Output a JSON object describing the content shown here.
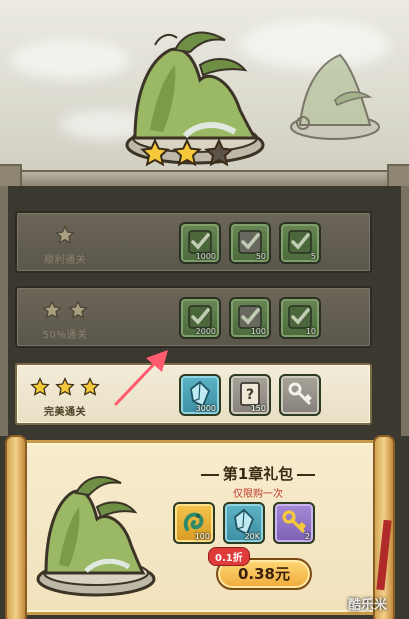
{
  "level": {
    "stars_earned": 2,
    "stars_total": 3
  },
  "tiers": [
    {
      "label": "顺利通关",
      "stars": 1,
      "rewards": [
        {
          "icon": "green-check-token-icon",
          "qty": "1000"
        },
        {
          "icon": "green-check-token-icon",
          "qty": "50"
        },
        {
          "icon": "green-check-token-icon",
          "qty": "5"
        }
      ]
    },
    {
      "label": "50%通关",
      "stars": 2,
      "rewards": [
        {
          "icon": "green-check-token-icon",
          "qty": "2000"
        },
        {
          "icon": "green-check-token-icon",
          "qty": "100"
        },
        {
          "icon": "green-check-token-icon",
          "qty": "10"
        }
      ]
    },
    {
      "label": "完美通关",
      "stars": 3,
      "rewards": [
        {
          "icon": "blue-crystal-icon",
          "qty": "3000"
        },
        {
          "icon": "mystery-scroll-icon",
          "qty": "150"
        },
        {
          "icon": "key-icon",
          "qty": ""
        }
      ]
    }
  ],
  "gift_pack": {
    "title": "第1章礼包",
    "limit_text": "仅限购一次",
    "items": [
      {
        "icon": "jade-dragon-icon",
        "qty": "100"
      },
      {
        "icon": "blue-crystal-icon",
        "qty": "20K"
      },
      {
        "icon": "gold-key-icon",
        "qty": "2"
      }
    ],
    "discount_badge": "0.1折",
    "price_label": "0.38元"
  },
  "watermark": "酷乐米",
  "colors": {
    "star_gold": "#f5c93a",
    "star_empty": "#5a5448",
    "price_red": "#c0392b",
    "discount_red": "#e03b3b"
  }
}
